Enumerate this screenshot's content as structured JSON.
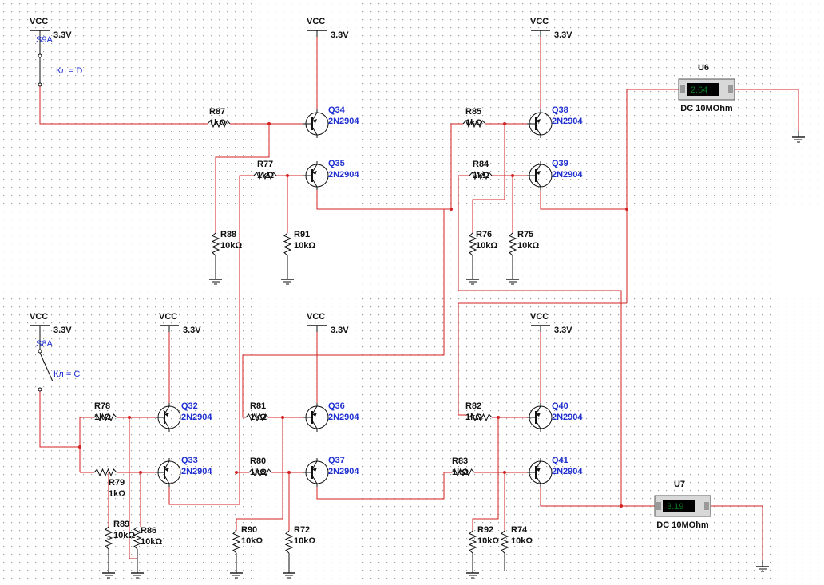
{
  "supply": {
    "name": "VCC",
    "voltage": "3.3V"
  },
  "meters": [
    {
      "id": "U6",
      "reading": "2.64",
      "mode": "DC  10MOhm"
    },
    {
      "id": "U7",
      "reading": "3.19",
      "mode": "DC  10MOhm"
    }
  ],
  "switches": [
    {
      "id": "S9A",
      "key": "Кл = D"
    },
    {
      "id": "S8A",
      "key": "Кл = C"
    }
  ],
  "transistors": [
    {
      "id": "Q34",
      "model": "2N2904"
    },
    {
      "id": "Q35",
      "model": "2N2904"
    },
    {
      "id": "Q38",
      "model": "2N2904"
    },
    {
      "id": "Q39",
      "model": "2N2904"
    },
    {
      "id": "Q32",
      "model": "2N2904"
    },
    {
      "id": "Q33",
      "model": "2N2904"
    },
    {
      "id": "Q36",
      "model": "2N2904"
    },
    {
      "id": "Q37",
      "model": "2N2904"
    },
    {
      "id": "Q40",
      "model": "2N2904"
    },
    {
      "id": "Q41",
      "model": "2N2904"
    }
  ],
  "resistors": [
    {
      "id": "R87",
      "value": "1kΩ"
    },
    {
      "id": "R77",
      "value": "1kΩ"
    },
    {
      "id": "R88",
      "value": "10kΩ"
    },
    {
      "id": "R91",
      "value": "10kΩ"
    },
    {
      "id": "R85",
      "value": "1kΩ"
    },
    {
      "id": "R84",
      "value": "1kΩ"
    },
    {
      "id": "R76",
      "value": "10kΩ"
    },
    {
      "id": "R75",
      "value": "10kΩ"
    },
    {
      "id": "R78",
      "value": "1kΩ"
    },
    {
      "id": "R79",
      "value": "1kΩ"
    },
    {
      "id": "R89",
      "value": "10kΩ"
    },
    {
      "id": "R86",
      "value": "10kΩ"
    },
    {
      "id": "R81",
      "value": "1kΩ"
    },
    {
      "id": "R80",
      "value": "1kΩ"
    },
    {
      "id": "R90",
      "value": "10kΩ"
    },
    {
      "id": "R72",
      "value": "10kΩ"
    },
    {
      "id": "R82",
      "value": "1kΩ"
    },
    {
      "id": "R83",
      "value": "1kΩ"
    },
    {
      "id": "R92",
      "value": "10kΩ"
    },
    {
      "id": "R74",
      "value": "10kΩ"
    }
  ],
  "colors": {
    "wire": "#d42020",
    "component": "#111111",
    "refdes": "#1f2fd0",
    "grid_dot": "#9a9a9a",
    "meter_display": "#0b7a1f"
  }
}
